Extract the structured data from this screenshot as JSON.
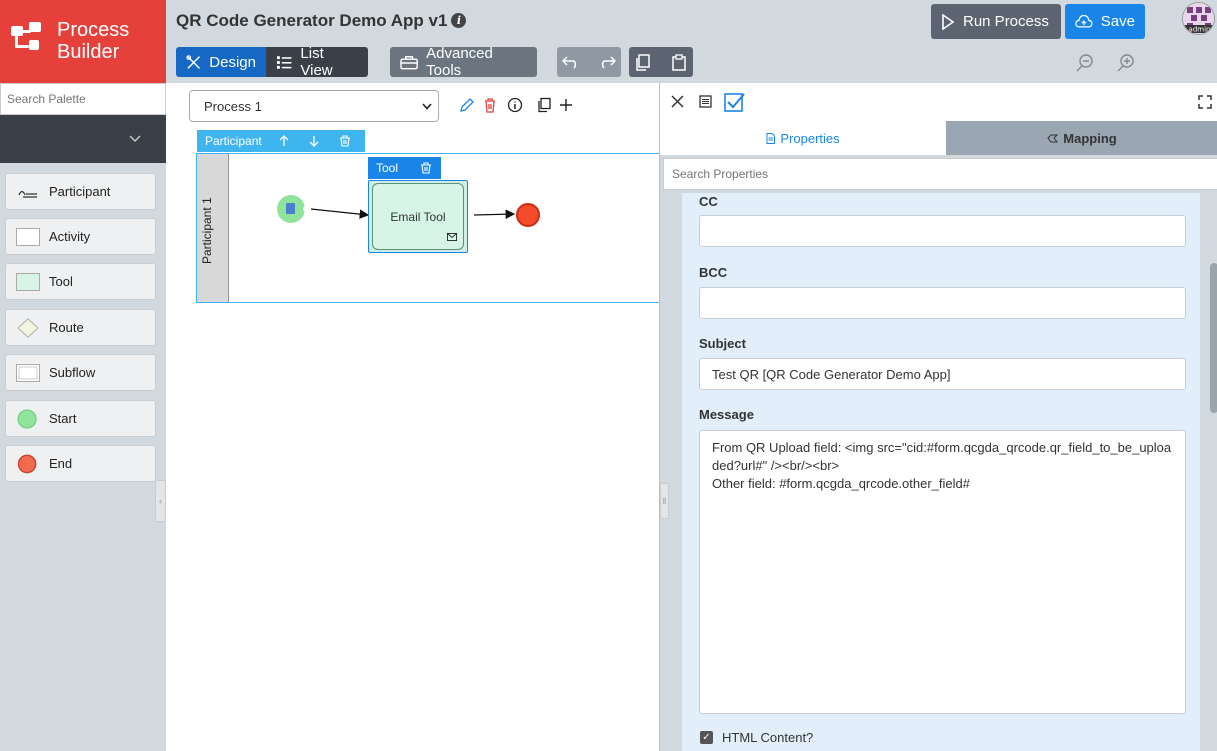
{
  "header": {
    "logo_line1": "Process",
    "logo_line2": "Builder",
    "app_title": "QR Code Generator Demo App v1",
    "info_glyph": "i",
    "run_label": "Run Process",
    "save_label": "Save",
    "avatar_text": "admin"
  },
  "toolbar": {
    "design_label": "Design",
    "list_view_label": "List View",
    "advanced_label": "Advanced Tools"
  },
  "palette": {
    "search_placeholder": "Search Palette",
    "items": [
      {
        "label": "Participant",
        "icon": "participant-icon"
      },
      {
        "label": "Activity",
        "icon": "activity-icon"
      },
      {
        "label": "Tool",
        "icon": "tool-icon"
      },
      {
        "label": "Route",
        "icon": "route-icon"
      },
      {
        "label": "Subflow",
        "icon": "subflow-icon"
      },
      {
        "label": "Start",
        "icon": "start-icon"
      },
      {
        "label": "End",
        "icon": "end-icon"
      }
    ]
  },
  "canvas": {
    "process_name": "Process 1",
    "lane_toolbar_label": "Participant",
    "lane_name": "Participant 1",
    "tool_toolbar_label": "Tool",
    "tool_node_label": "Email Tool"
  },
  "properties": {
    "tab_properties": "Properties",
    "tab_mapping": "Mapping",
    "search_placeholder": "Search Properties",
    "cc_label": "CC",
    "cc_value": "",
    "bcc_label": "BCC",
    "bcc_value": "",
    "subject_label": "Subject",
    "subject_value": "Test QR [QR Code Generator Demo App]",
    "message_label": "Message",
    "message_value": "From QR Upload field: <img src=\"cid:#form.qcgda_qrcode.qr_field_to_be_uploaded?url#\" /><br/><br>\nOther field: #form.qcgda_qrcode.other_field#",
    "html_content_label": "HTML Content?",
    "html_content_checked": true
  },
  "colors": {
    "brand_red": "#e5403a",
    "primary_blue": "#1a85e8",
    "participant_blue": "#3fb5f0",
    "tool_green": "#cdeee2",
    "start_green": "#8fe39a",
    "end_red": "#f44b2a"
  }
}
